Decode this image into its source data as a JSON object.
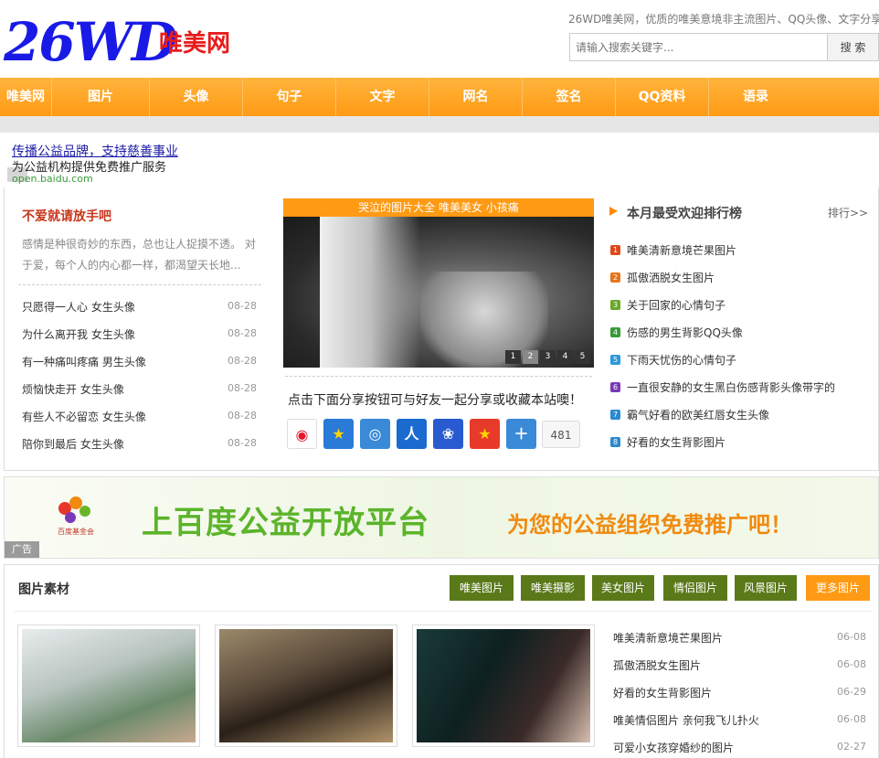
{
  "header": {
    "logo_num": "26WD",
    "logo_cn": "唯美网",
    "tagline": "26WD唯美网，优质的唯美意境非主流图片、QQ头像、文字分享",
    "search_placeholder": "请输入搜索关键字...",
    "search_button": "搜 索"
  },
  "nav": [
    "唯美网",
    "图片",
    "头像",
    "句子",
    "文字",
    "网名",
    "签名",
    "QQ资料",
    "语录"
  ],
  "ad_text": {
    "title": "传播公益品牌，支持慈善事业",
    "sub": "为公益机构提供免费推广服务",
    "url": "open.baidu.com"
  },
  "left": {
    "heading": "不爱就请放手吧",
    "desc": "感情是种很奇妙的东西，总也让人捉摸不透。 对于爱，每个人的内心都一样，都渴望天长地...",
    "items": [
      {
        "title": "只愿得一人心 女生头像",
        "date": "08-28"
      },
      {
        "title": "为什么离开我 女生头像",
        "date": "08-28"
      },
      {
        "title": "有一种痛叫疼痛 男生头像",
        "date": "08-28"
      },
      {
        "title": "烦恼快走开 女生头像",
        "date": "08-28"
      },
      {
        "title": "有些人不必留恋 女生头像",
        "date": "08-28"
      },
      {
        "title": "陪你到最后 女生头像",
        "date": "08-28"
      }
    ]
  },
  "slider": {
    "caption": "哭泣的图片大全 唯美美女 小孩痛",
    "pages": [
      "1",
      "2",
      "3",
      "4",
      "5"
    ],
    "share_text": "点击下面分享按钮可与好友一起分享或收藏本站噢！",
    "share_count": "481"
  },
  "ranking": {
    "title": "本月最受欢迎排行榜",
    "more": "排行>>",
    "items": [
      "唯美清新意境芒果图片",
      "孤傲洒脱女生图片",
      "关于回家的心情句子",
      "伤感的男生背影QQ头像",
      "下雨天忧伤的心情句子",
      "一直很安静的女生黑白伤感背影头像带字的",
      "霸气好看的欧美红唇女生头像",
      "好看的女生背影图片"
    ],
    "colors": [
      "#e0491c",
      "#e8741a",
      "#6aa82a",
      "#3a9a3a",
      "#2a9ad8",
      "#7a3ab8",
      "#2a8ad0",
      "#2a8ad0"
    ]
  },
  "banner": {
    "big": "上百度公益开放平台",
    "small": "为您的公益组织免费推广吧！",
    "foundation": "百度基金会",
    "ad_tag": "广告"
  },
  "materials": {
    "title": "图片素材",
    "tabs": [
      "唯美图片",
      "唯美摄影",
      "美女图片",
      "情侣图片",
      "风景图片",
      "更多图片"
    ],
    "items": [
      {
        "title": "唯美清新意境芒果图片",
        "date": "06-08"
      },
      {
        "title": "孤傲洒脱女生图片",
        "date": "06-08"
      },
      {
        "title": "好看的女生背影图片",
        "date": "06-29"
      },
      {
        "title": "唯美情侣图片 亲何我飞儿扑火",
        "date": "06-08"
      },
      {
        "title": "可爱小女孩穿婚纱的图片",
        "date": "02-27"
      }
    ]
  }
}
